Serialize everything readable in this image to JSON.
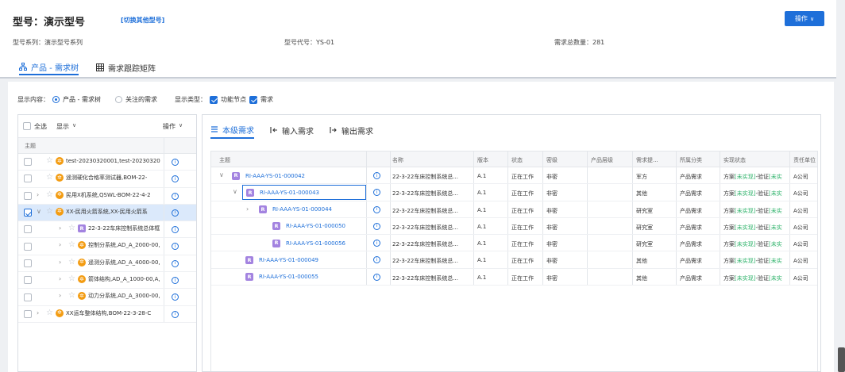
{
  "header": {
    "title": "型号：演示型号",
    "switch_link": "[切换其他型号]",
    "op_button": "操作",
    "meta": [
      "型号系列：演示型号系列",
      "型号代号：YS-01",
      "需求总数量：281"
    ]
  },
  "tabs": [
    {
      "label": "产品 - 需求树",
      "icon": "tree-icon"
    },
    {
      "label": "需求跟踪矩阵",
      "icon": "grid-icon"
    }
  ],
  "filter": {
    "display_label": "显示内容：",
    "radio1": "产品 - 需求树",
    "radio2": "关注的需求",
    "type_label": "显示类型：",
    "check1": "功能节点",
    "check2": "需求"
  },
  "left": {
    "select_all": "全选",
    "display": "显示",
    "ops": "操作",
    "col_header": "主题",
    "rows": [
      {
        "name": "test-20230320001,test-20230320",
        "level": 0
      },
      {
        "name": "遥测硬化合格率测试器,BOM-22-",
        "level": 0
      },
      {
        "name": "民用X机系统,QSWL-BOM-22-4-2",
        "level": 0
      },
      {
        "name": "XX-民用火箭系统,XX-民用火箭系",
        "level": 0
      },
      {
        "name": "22-3-22车床控制系统总体框",
        "level": 1
      },
      {
        "name": "控制分系统,AD_A_2000-00,",
        "level": 1
      },
      {
        "name": "遥测分系统,AD_A_4000-00,",
        "level": 1
      },
      {
        "name": "箭体结构,AD_A_1000-00,A,",
        "level": 1
      },
      {
        "name": "动力分系统,AD_A_3000-00,",
        "level": 1
      },
      {
        "name": "XX运车整体结构,BOM-22-3-28-C",
        "level": 0
      }
    ]
  },
  "right": {
    "tabs": [
      "本级需求",
      "输入需求",
      "输出需求"
    ],
    "columns": [
      "主题",
      "名称",
      "版本",
      "状态",
      "密级",
      "产品层级",
      "需求提...",
      "所属分类",
      "实现状态",
      "责任单位"
    ],
    "rows": [
      {
        "id": "RI-AAA-YS-01-000042",
        "name": "22-3-22车床控制系统总...",
        "ver": "A.1",
        "status": "正在工作",
        "secret": "非密",
        "level": "",
        "src": "军方",
        "cat": "产品需求",
        "impl_a": "方案",
        "impl_b": "[未实现]",
        "impl_c": "-验证",
        "impl_d": "[未实",
        "unit": "A公司"
      },
      {
        "id": "RI-AAA-YS-01-000043",
        "name": "22-3-22车床控制系统总...",
        "ver": "A.1",
        "status": "正在工作",
        "secret": "非密",
        "level": "",
        "src": "其他",
        "cat": "产品需求",
        "impl_a": "方案",
        "impl_b": "[未实现]",
        "impl_c": "-验证",
        "impl_d": "[未实",
        "unit": "A公司"
      },
      {
        "id": "RI-AAA-YS-01-000044",
        "name": "22-3-22车床控制系统总...",
        "ver": "A.1",
        "status": "正在工作",
        "secret": "非密",
        "level": "",
        "src": "研究室",
        "cat": "产品需求",
        "impl_a": "方案",
        "impl_b": "[未实现]",
        "impl_c": "-验证",
        "impl_d": "[未实",
        "unit": "A公司"
      },
      {
        "id": "RI-AAA-YS-01-000050",
        "name": "22-3-22车床控制系统总...",
        "ver": "A.1",
        "status": "正在工作",
        "secret": "非密",
        "level": "",
        "src": "研究室",
        "cat": "产品需求",
        "impl_a": "方案",
        "impl_b": "[未实现]",
        "impl_c": "-验证",
        "impl_d": "[未实",
        "unit": "A公司"
      },
      {
        "id": "RI-AAA-YS-01-000056",
        "name": "22-3-22车床控制系统总...",
        "ver": "A.1",
        "status": "正在工作",
        "secret": "非密",
        "level": "",
        "src": "研究室",
        "cat": "产品需求",
        "impl_a": "方案",
        "impl_b": "[未实现]",
        "impl_c": "-验证",
        "impl_d": "[未实",
        "unit": "A公司"
      },
      {
        "id": "RI-AAA-YS-01-000049",
        "name": "22-3-22车床控制系统总...",
        "ver": "A.1",
        "status": "正在工作",
        "secret": "非密",
        "level": "",
        "src": "其他",
        "cat": "产品需求",
        "impl_a": "方案",
        "impl_b": "[未实现]",
        "impl_c": "-验证",
        "impl_d": "[未实",
        "unit": "A公司"
      },
      {
        "id": "RI-AAA-YS-01-000055",
        "name": "22-3-22车床控制系统总...",
        "ver": "A.1",
        "status": "正在工作",
        "secret": "非密",
        "level": "",
        "src": "其他",
        "cat": "产品需求",
        "impl_a": "方案",
        "impl_b": "[未实现]",
        "impl_c": "-验证",
        "impl_d": "[未实",
        "unit": "A公司"
      }
    ]
  },
  "colors": {
    "accent": "#1e6fd9",
    "gear": "#f39c12",
    "badge": "#a383e0",
    "impl_green": "#2fb36b"
  }
}
